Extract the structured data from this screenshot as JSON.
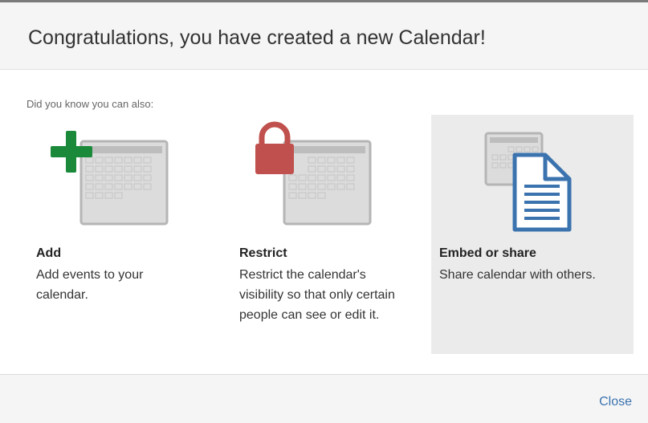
{
  "dialog": {
    "title": "Congratulations, you have created a new Calendar!",
    "intro": "Did you know you can also:",
    "close_label": "Close"
  },
  "options": [
    {
      "title": "Add",
      "description": "Add events to your calendar.",
      "icon": "add-calendar-icon",
      "accent": "#1a8a3a",
      "selected": false
    },
    {
      "title": "Restrict",
      "description": "Restrict the calendar's visibility so that only certain people can see or edit it.",
      "icon": "lock-calendar-icon",
      "accent": "#c0504d",
      "selected": false
    },
    {
      "title": "Embed or share",
      "description": "Share calendar with others.",
      "icon": "share-document-icon",
      "accent": "#3b73af",
      "selected": true
    }
  ],
  "colors": {
    "link": "#3b73af",
    "selected_bg": "#ebebeb"
  }
}
